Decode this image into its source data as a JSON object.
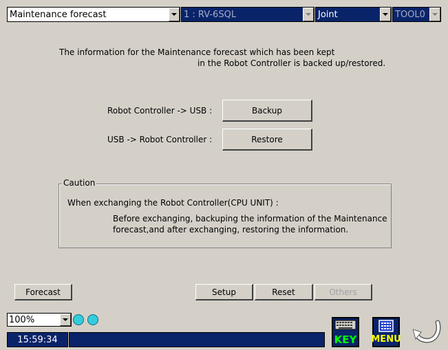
{
  "toolbar": {
    "screen_select": "Maintenance forecast",
    "robot_select": "1 : RV-6SQL",
    "jog_mode_select": "Joint",
    "tool_select": "TOOL0"
  },
  "info": {
    "line1": "The information for the Maintenance forecast which has been kept",
    "line2": "in the Robot Controller is backed up/restored."
  },
  "actions": {
    "backup_label": "Robot Controller -> USB  :",
    "backup_button": "Backup",
    "restore_label": "USB -> Robot Controller  :",
    "restore_button": "Restore"
  },
  "caution": {
    "title": "Caution",
    "line1": "When exchanging the Robot Controller(CPU UNIT) :",
    "line2": "Before exchanging, backuping the information of the Maintenance",
    "line3": "forecast,and after exchanging,  restoring the information."
  },
  "bottom_buttons": {
    "forecast": "Forecast",
    "setup": "Setup",
    "reset": "Reset",
    "others": "Others"
  },
  "status": {
    "zoom": "100%",
    "time": "15:59:34",
    "key_label": "KEY",
    "menu_label": "MENU"
  },
  "colors": {
    "background": "#d4d0c8",
    "selected_navy": "#0a246a",
    "led_cyan": "#33ccdd",
    "key_icon_text": "#00ff00",
    "menu_icon_text": "#ffff00"
  },
  "icons": {
    "keyboard": "keyboard-icon",
    "menu": "menu-icon",
    "back": "return-arrow-icon"
  }
}
